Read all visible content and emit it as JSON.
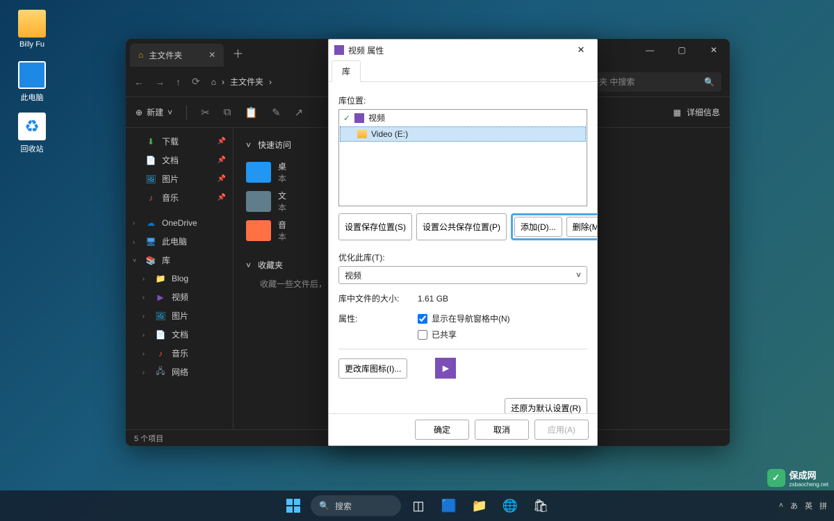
{
  "desktop": {
    "icons": [
      {
        "name": "billy-fu",
        "label": "Billy Fu"
      },
      {
        "name": "this-pc",
        "label": "此电脑"
      },
      {
        "name": "recycle",
        "label": "回收站"
      }
    ]
  },
  "explorer": {
    "tab_title": "主文件夹",
    "breadcrumb": "主文件夹",
    "search_placeholder": "文件夹 中搜索",
    "new_btn": "新建",
    "details_btn": "详细信息",
    "sidebar": {
      "quick": [
        {
          "icon": "download-icon",
          "label": "下载",
          "color": "#4caf50"
        },
        {
          "icon": "document-icon",
          "label": "文档",
          "color": "#42a5f5"
        },
        {
          "icon": "picture-icon",
          "label": "图片",
          "color": "#29b6f6"
        },
        {
          "icon": "music-icon",
          "label": "音乐",
          "color": "#ef5350"
        }
      ],
      "onedrive": "OneDrive",
      "thispc": "此电脑",
      "library": "库",
      "lib_items": [
        {
          "icon": "blog-icon",
          "label": "Blog",
          "color": "#ffd66e"
        },
        {
          "icon": "video-icon",
          "label": "视频",
          "color": "#7b4fb5"
        },
        {
          "icon": "picture-icon",
          "label": "图片",
          "color": "#29b6f6"
        },
        {
          "icon": "document-icon",
          "label": "文档",
          "color": "#42a5f5"
        },
        {
          "icon": "music-icon",
          "label": "音乐",
          "color": "#ef5350"
        },
        {
          "icon": "network-icon",
          "label": "网络",
          "color": "#78909c"
        }
      ]
    },
    "main": {
      "quick_access": "快速访问",
      "favorites": "收藏夹",
      "fav_hint": "收藏一些文件后，",
      "folders": [
        {
          "label_top": "桌",
          "label_bot": "本",
          "color": "#2196f3"
        },
        {
          "label_top": "文",
          "label_bot": "本",
          "color": "#607d8b"
        },
        {
          "label_top": "音",
          "label_bot": "本",
          "color": "#ff7043"
        }
      ]
    },
    "status": "5 个项目"
  },
  "props": {
    "title": "视频 属性",
    "tab": "库",
    "loc_label": "库位置:",
    "loc_items": [
      {
        "label": "视频",
        "indent": 0,
        "icon": "video"
      },
      {
        "label": "Video (E:)",
        "indent": 1,
        "selected": true,
        "icon": "folder"
      }
    ],
    "btn_set_save": "设置保存位置(S)",
    "btn_set_public": "设置公共保存位置(P)",
    "btn_add": "添加(D)...",
    "btn_remove": "删除(M)",
    "optimize_label": "优化此库(T):",
    "optimize_value": "视频",
    "size_label": "库中文件的大小:",
    "size_value": "1.61 GB",
    "attr_label": "属性:",
    "chk_nav": "显示在导航窗格中(N)",
    "chk_shared": "已共享",
    "chk_nav_checked": true,
    "chk_shared_checked": false,
    "btn_icon": "更改库图标(I)...",
    "btn_restore": "还原为默认设置(R)",
    "btn_ok": "确定",
    "btn_cancel": "取消",
    "btn_apply": "应用(A)"
  },
  "taskbar": {
    "search": "搜索",
    "ime": [
      "あ",
      "英",
      "拼"
    ]
  },
  "watermark": {
    "name": "保成网",
    "sub": "zsbaocheng.net"
  }
}
